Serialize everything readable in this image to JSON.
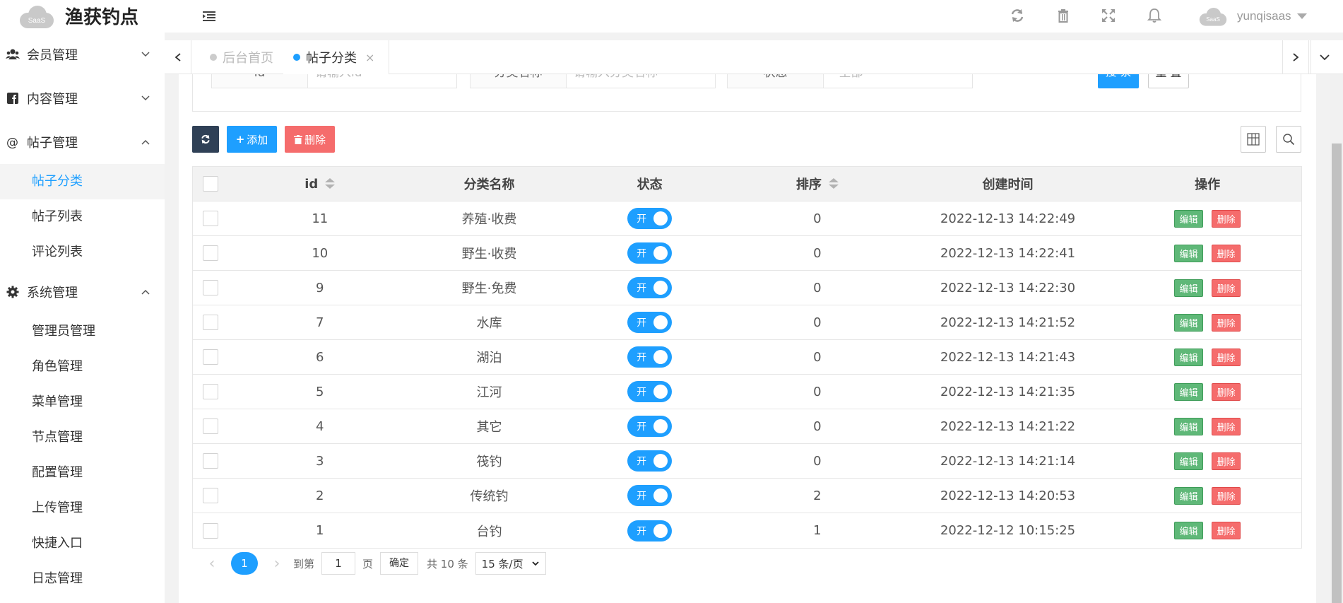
{
  "header": {
    "logo_text": "SaaS",
    "title": "渔获钓点",
    "username": "yunqisaas",
    "icons": [
      "refresh-icon",
      "trash-icon",
      "fullscreen-icon",
      "bell-icon"
    ]
  },
  "sidebar": {
    "groups": [
      {
        "label": "会员管理",
        "icon": "users-icon",
        "expanded": false
      },
      {
        "label": "内容管理",
        "icon": "facebook-icon",
        "expanded": false
      },
      {
        "label": "帖子管理",
        "icon": "at-icon",
        "expanded": true,
        "items": [
          "帖子分类",
          "帖子列表",
          "评论列表"
        ]
      },
      {
        "label": "系统管理",
        "icon": "gear-icon",
        "expanded": true,
        "items": [
          "管理员管理",
          "角色管理",
          "菜单管理",
          "节点管理",
          "配置管理",
          "上传管理",
          "快捷入口",
          "日志管理"
        ]
      }
    ],
    "active_item": "帖子分类"
  },
  "tabs": [
    {
      "label": "后台首页",
      "active": false
    },
    {
      "label": "帖子分类",
      "active": true,
      "close": "×"
    }
  ],
  "search": {
    "fields": [
      {
        "label": "id",
        "placeholder": "请输入id"
      },
      {
        "label": "分类名称",
        "placeholder": "请输入分类名称"
      },
      {
        "label": "状态",
        "placeholder": "- 全部 -"
      }
    ],
    "search_btn": "搜 索",
    "reset_btn": "重 置"
  },
  "toolbar": {
    "add_label": "添加",
    "delete_label": "删除"
  },
  "table": {
    "headers": [
      "id",
      "分类名称",
      "状态",
      "排序",
      "创建时间",
      "操作"
    ],
    "rows": [
      {
        "id": "11",
        "name": "养殖·收费",
        "status": "开",
        "sort": "0",
        "time": "2022-12-13 14:22:49"
      },
      {
        "id": "10",
        "name": "野生·收费",
        "status": "开",
        "sort": "0",
        "time": "2022-12-13 14:22:41"
      },
      {
        "id": "9",
        "name": "野生·免费",
        "status": "开",
        "sort": "0",
        "time": "2022-12-13 14:22:30"
      },
      {
        "id": "7",
        "name": "水库",
        "status": "开",
        "sort": "0",
        "time": "2022-12-13 14:21:52"
      },
      {
        "id": "6",
        "name": "湖泊",
        "status": "开",
        "sort": "0",
        "time": "2022-12-13 14:21:43"
      },
      {
        "id": "5",
        "name": "江河",
        "status": "开",
        "sort": "0",
        "time": "2022-12-13 14:21:35"
      },
      {
        "id": "4",
        "name": "其它",
        "status": "开",
        "sort": "0",
        "time": "2022-12-13 14:21:22"
      },
      {
        "id": "3",
        "name": "筏钓",
        "status": "开",
        "sort": "0",
        "time": "2022-12-13 14:21:14"
      },
      {
        "id": "2",
        "name": "传统钓",
        "status": "开",
        "sort": "2",
        "time": "2022-12-13 14:20:53"
      },
      {
        "id": "1",
        "name": "台钓",
        "status": "开",
        "sort": "1",
        "time": "2022-12-12 10:15:25"
      }
    ],
    "edit_label": "编辑",
    "delete_label": "删除"
  },
  "pager": {
    "current": "1",
    "goto_prefix": "到第",
    "goto_value": "1",
    "goto_suffix": "页",
    "confirm": "确定",
    "total": "共 10 条",
    "page_size": "15 条/页"
  },
  "colors": {
    "primary": "#1e9fff",
    "edit": "#5fb878",
    "danger": "#f56c6c",
    "dark_button": "#2f4056"
  }
}
